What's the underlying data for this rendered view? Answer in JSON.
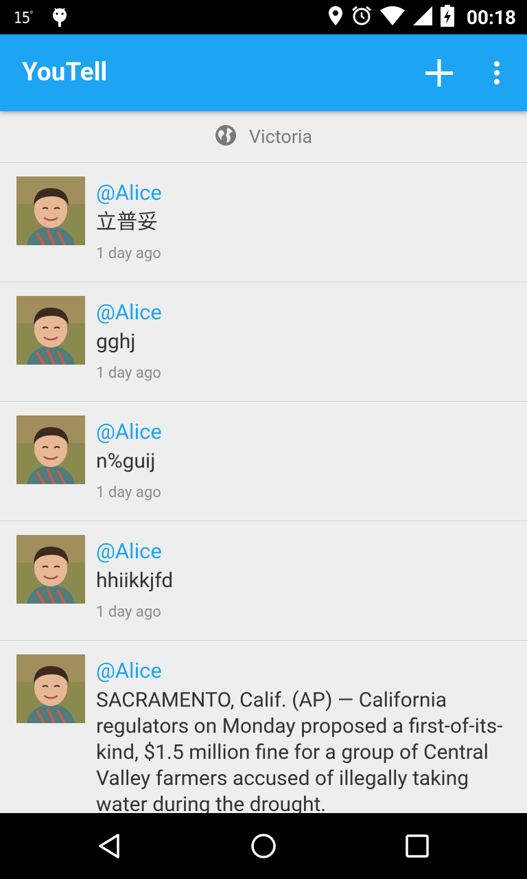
{
  "status_bar": {
    "temperature": "15",
    "temperature_unit": "°",
    "time": "00:18",
    "icons": [
      "android-icon",
      "location-icon",
      "alarm-icon",
      "wifi-icon",
      "signal-icon",
      "battery-charging-icon"
    ]
  },
  "app_bar": {
    "title": "YouTell",
    "add_icon": "plus-icon",
    "menu_icon": "overflow-menu-icon",
    "color": "#1da4f2"
  },
  "location": {
    "icon": "globe-icon",
    "label": "Victoria"
  },
  "posts": [
    {
      "username": "@Alice",
      "text": "立普妥",
      "time": "1 day ago"
    },
    {
      "username": "@Alice",
      "text": "gghj",
      "time": "1 day ago"
    },
    {
      "username": "@Alice",
      "text": "n%guij",
      "time": "1 day ago"
    },
    {
      "username": "@Alice",
      "text": "hhiikkjfd",
      "time": "1 day ago"
    },
    {
      "username": "@Alice",
      "text": "SACRAMENTO, Calif. (AP) — California regulators on Monday proposed a first-of-its-kind, $1.5 million fine for a group of Central Valley farmers accused of illegally taking water during the drought.",
      "time": ""
    }
  ],
  "nav_bar": {
    "icons": [
      "back-icon",
      "home-icon",
      "recents-icon"
    ]
  }
}
